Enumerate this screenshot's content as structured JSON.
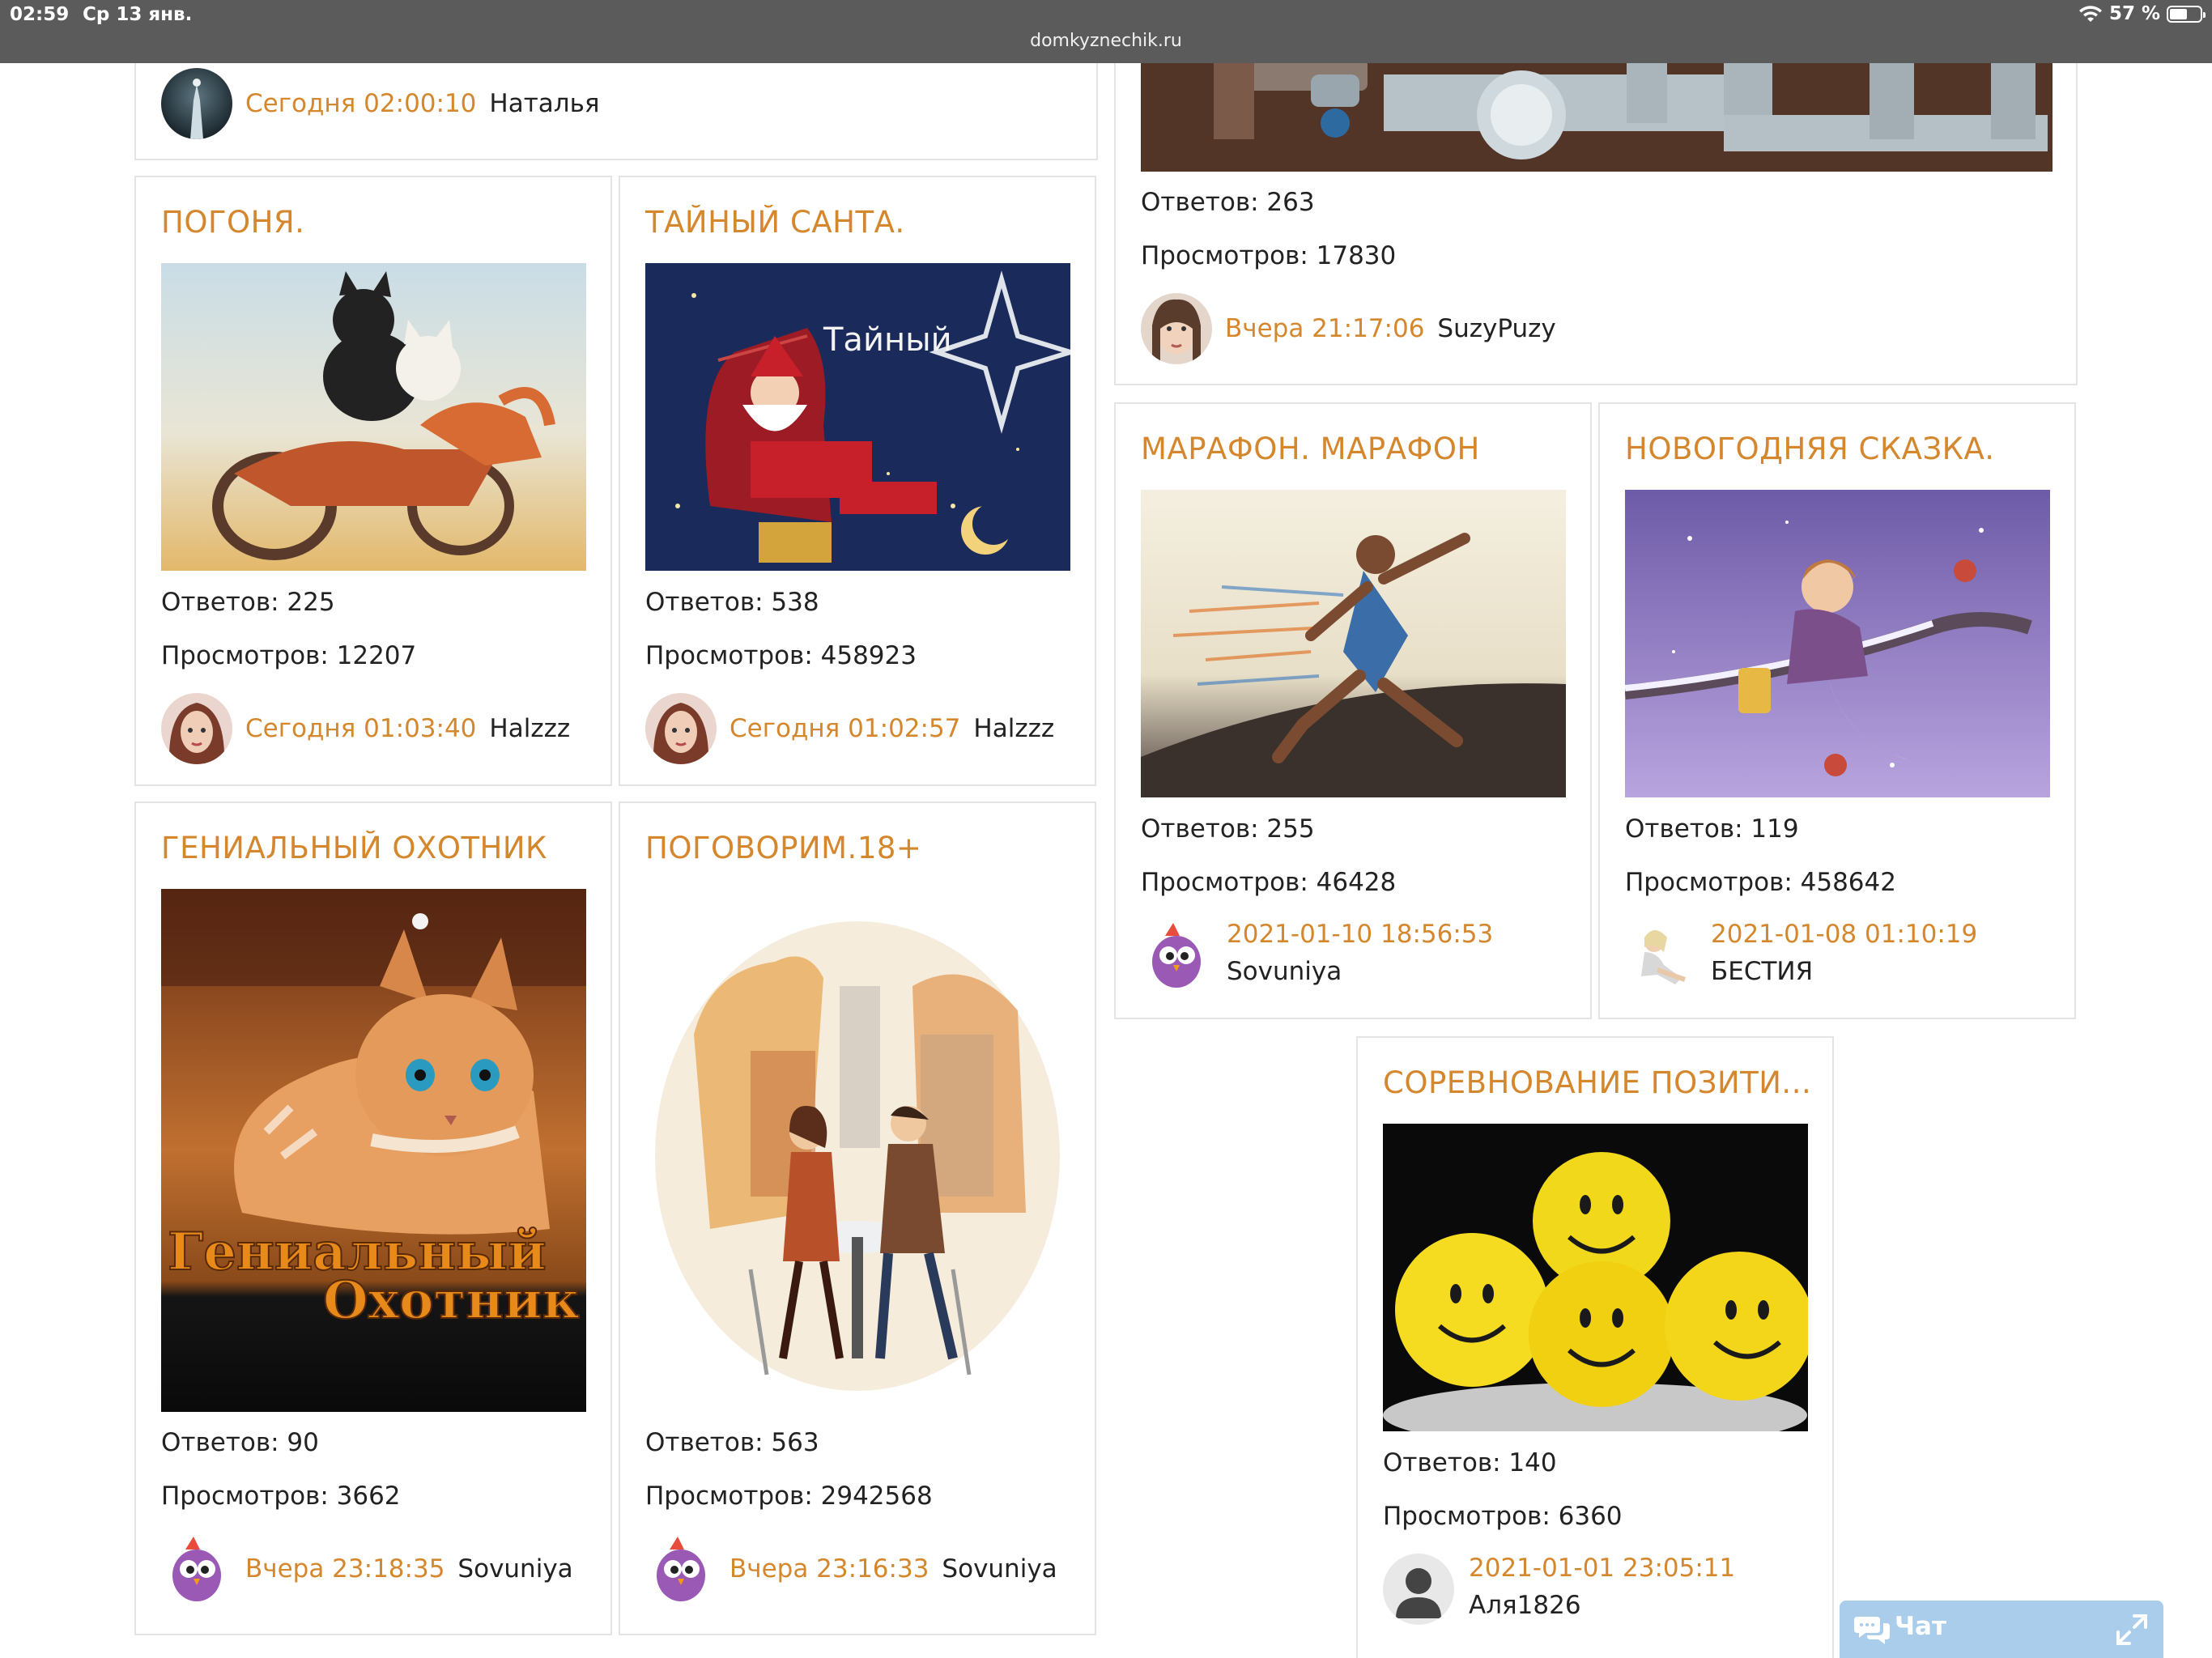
{
  "status_bar": {
    "time": "02:59",
    "date": "Ср 13 янв.",
    "url": "domkyznechik.ru",
    "battery": "57 %",
    "battery_level": 0.57
  },
  "labels": {
    "replies": "Ответов: ",
    "views": "Просмотров: "
  },
  "top_left_card": {
    "time": "Сегодня 02:00:10",
    "user": "Наталья"
  },
  "top_right_card": {
    "replies": "263",
    "views": "17830",
    "time": "Вчера 21:17:06",
    "user": "SuzyPuzy"
  },
  "topics": [
    {
      "id": "pogonya",
      "title": "ПОГОНЯ.",
      "replies": "225",
      "views": "12207",
      "time": "Сегодня 01:03:40",
      "user": "Halzzz",
      "image": "kittens-motorcycle"
    },
    {
      "id": "santa",
      "title": "ТАЙНЫЙ САНТА.",
      "replies": "538",
      "views": "458923",
      "time": "Сегодня 01:02:57",
      "user": "Halzzz",
      "image": "secret-santa",
      "image_text": "Тайный"
    },
    {
      "id": "marathon",
      "title": "МАРАФОН. МАРАФОН",
      "replies": "255",
      "views": "46428",
      "time": "2021-01-10 18:56:53",
      "user": "Sovuniya",
      "image": "runner"
    },
    {
      "id": "fairytale",
      "title": "НОВОГОДНЯЯ СКАЗКА.",
      "replies": "119",
      "views": "458642",
      "time": "2021-01-08 01:10:19",
      "user": "БЕСТИЯ",
      "image": "angel-moon"
    },
    {
      "id": "hunter",
      "title": "ГЕНИАЛЬНЫЙ ОХОТНИК",
      "replies": "90",
      "views": "3662",
      "time": "Вчера 23:18:35",
      "user": "Sovuniya",
      "image": "cat-hunter",
      "image_text_1": "Гениальный",
      "image_text_2": "Охотник"
    },
    {
      "id": "talk",
      "title": "ПОГОВОРИМ.18+",
      "replies": "563",
      "views": "2942568",
      "time": "Вчера 23:16:33",
      "user": "Sovuniya",
      "image": "cafe-couple"
    },
    {
      "id": "positive",
      "title": "СОРЕВНОВАНИЕ ПОЗИТИ...",
      "replies": "140",
      "views": "6360",
      "time": "2021-01-01 23:05:11",
      "user": "Аля1826",
      "image": "smiley-balls"
    }
  ],
  "chat": {
    "label": "Чат"
  },
  "colors": {
    "accent": "#d4872c",
    "statusbar": "#5b5b5b",
    "chat": "#a9cdea"
  }
}
